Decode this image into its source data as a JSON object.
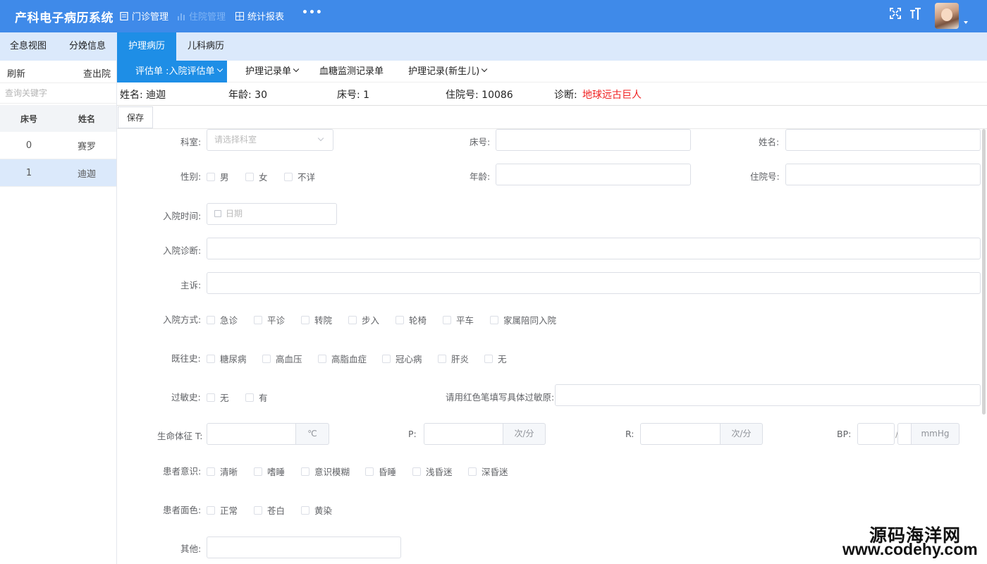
{
  "app": {
    "title": "产科电子病历系统",
    "nav": [
      {
        "label": "门诊管理",
        "icon": "document-icon"
      },
      {
        "label": "住院管理",
        "icon": "bar-chart-icon"
      },
      {
        "label": "统计报表",
        "icon": "grid-icon"
      }
    ],
    "more": "•••",
    "fullscreen_icon": "fullscreen-icon",
    "fontsize_icon": "font-size-icon"
  },
  "module_tabs": [
    "全息视图",
    "分娩信息",
    "护理病历",
    "儿科病历"
  ],
  "left": {
    "refresh": "刷新",
    "discharge": "查出院",
    "search_placeholder": "查询关键字",
    "columns": [
      "床号",
      "姓名"
    ],
    "rows": [
      {
        "bed": "0",
        "name": "赛罗"
      },
      {
        "bed": "1",
        "name": "迪迦"
      }
    ]
  },
  "sub_tabs": [
    "评估单 :入院评估单",
    "护理记录单",
    "血糖监测记录单",
    "护理记录(新生儿)"
  ],
  "patient": {
    "name": "姓名: 迪迦",
    "age": "年龄: 30",
    "bed": "床号: 1",
    "inpatient_no": "住院号: 10086",
    "diagnosis_label": "诊断:",
    "diagnosis_value": "地球远古巨人"
  },
  "toolbar": {
    "save": "保存"
  },
  "form": {
    "dept_label": "科室:",
    "dept_placeholder": "请选择科室",
    "bed_label": "床号:",
    "name_label": "姓名:",
    "gender_label": "性别:",
    "gender_options": [
      "男",
      "女",
      "不详"
    ],
    "age_label": "年龄:",
    "inpatient_label": "住院号:",
    "admit_time_label": "入院时间:",
    "date_placeholder": "日期",
    "admit_diag_label": "入院诊断:",
    "complaint_label": "主诉:",
    "admit_mode_label": "入院方式:",
    "admit_mode_options": [
      "急诊",
      "平诊",
      "转院",
      "步入",
      "轮椅",
      "平车",
      "家属陪同入院"
    ],
    "history_label": "既往史:",
    "history_options": [
      "糖尿病",
      "高血压",
      "高脂血症",
      "冠心病",
      "肝炎",
      "无"
    ],
    "allergy_label": "过敏史:",
    "allergy_options": [
      "无",
      "有"
    ],
    "allergen_label": "请用红色笔填写具体过敏原:",
    "vitals_label": "生命体征 T:",
    "temp_unit": "℃",
    "p_label": "P:",
    "p_unit": "次/分",
    "r_label": "R:",
    "r_unit": "次/分",
    "bp_label": "BP:",
    "bp_sep": "/",
    "bp_unit": "mmHg",
    "conscious_label": "患者意识:",
    "conscious_options": [
      "清晰",
      "嗜睡",
      "意识模糊",
      "昏睡",
      "浅昏迷",
      "深昏迷"
    ],
    "complexion_label": "患者面色:",
    "complexion_options": [
      "正常",
      "苍白",
      "黄染"
    ],
    "other_label": "其他:"
  },
  "watermark": {
    "line1": "源码海洋网",
    "line2": "www.codehy.com"
  }
}
